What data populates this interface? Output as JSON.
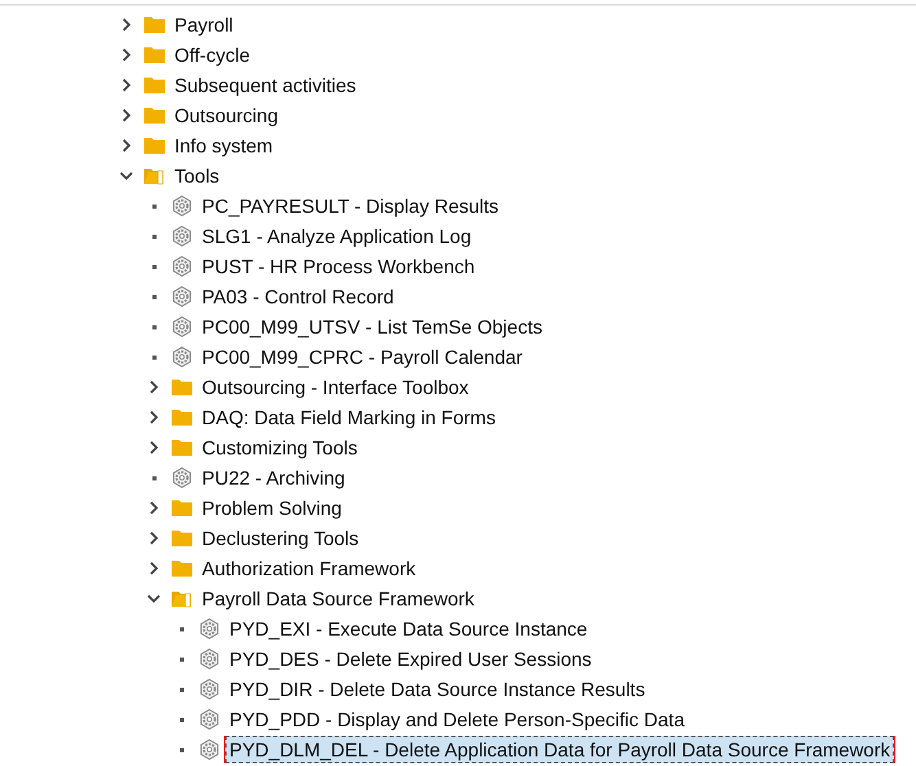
{
  "tree": {
    "items": [
      {
        "kind": "folder",
        "label": "Payroll",
        "expanded": false,
        "selected": false
      },
      {
        "kind": "folder",
        "label": "Off-cycle",
        "expanded": false,
        "selected": false
      },
      {
        "kind": "folder",
        "label": "Subsequent activities",
        "expanded": false,
        "selected": false
      },
      {
        "kind": "folder",
        "label": "Outsourcing",
        "expanded": false,
        "selected": false
      },
      {
        "kind": "folder",
        "label": "Info system",
        "expanded": false,
        "selected": false
      },
      {
        "kind": "folder",
        "label": "Tools",
        "expanded": true,
        "selected": false,
        "children": [
          {
            "kind": "transaction",
            "label": "PC_PAYRESULT - Display Results",
            "selected": false
          },
          {
            "kind": "transaction",
            "label": "SLG1 - Analyze Application Log",
            "selected": false
          },
          {
            "kind": "transaction",
            "label": "PUST - HR Process Workbench",
            "selected": false
          },
          {
            "kind": "transaction",
            "label": "PA03 - Control Record",
            "selected": false
          },
          {
            "kind": "transaction",
            "label": "PC00_M99_UTSV - List TemSe Objects",
            "selected": false
          },
          {
            "kind": "transaction",
            "label": "PC00_M99_CPRC - Payroll Calendar",
            "selected": false
          },
          {
            "kind": "folder",
            "label": "Outsourcing - Interface Toolbox",
            "expanded": false,
            "selected": false
          },
          {
            "kind": "folder",
            "label": "DAQ: Data Field Marking in Forms",
            "expanded": false,
            "selected": false
          },
          {
            "kind": "folder",
            "label": "Customizing Tools",
            "expanded": false,
            "selected": false
          },
          {
            "kind": "transaction",
            "label": "PU22 - Archiving",
            "selected": false
          },
          {
            "kind": "folder",
            "label": "Problem Solving",
            "expanded": false,
            "selected": false
          },
          {
            "kind": "folder",
            "label": "Declustering Tools",
            "expanded": false,
            "selected": false
          },
          {
            "kind": "folder",
            "label": "Authorization Framework",
            "expanded": false,
            "selected": false
          },
          {
            "kind": "folder",
            "label": "Payroll Data Source Framework",
            "expanded": true,
            "selected": false,
            "children": [
              {
                "kind": "transaction",
                "label": "PYD_EXI - Execute Data Source Instance",
                "selected": false
              },
              {
                "kind": "transaction",
                "label": "PYD_DES - Delete Expired User Sessions",
                "selected": false
              },
              {
                "kind": "transaction",
                "label": "PYD_DIR - Delete Data Source Instance Results",
                "selected": false
              },
              {
                "kind": "transaction",
                "label": "PYD_PDD - Display and Delete Person-Specific Data",
                "selected": false
              },
              {
                "kind": "transaction",
                "label": "PYD_DLM_DEL - Delete Application Data for Payroll Data Source Framework",
                "selected": true
              }
            ]
          }
        ]
      }
    ]
  }
}
